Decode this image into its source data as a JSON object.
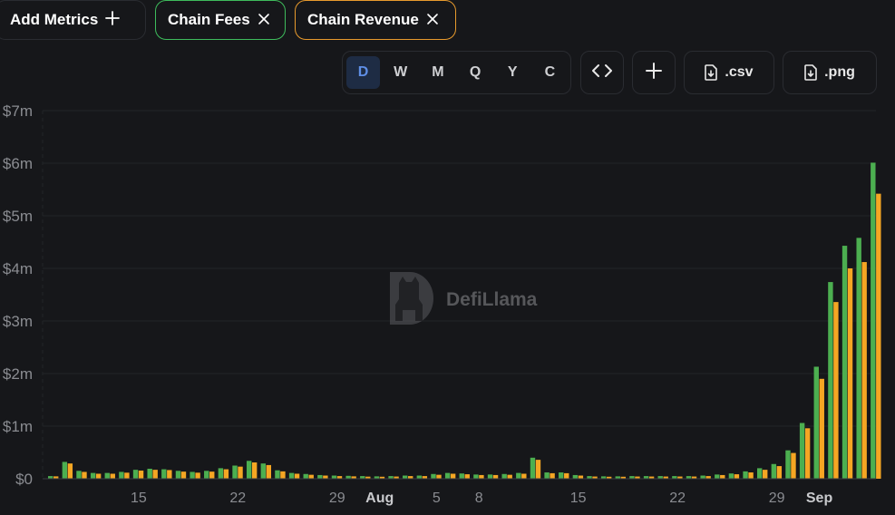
{
  "chips": {
    "add_metrics": "Add Metrics",
    "fees": "Chain Fees",
    "revenue": "Chain Revenue"
  },
  "toolbar": {
    "periods": [
      "D",
      "W",
      "M",
      "Q",
      "Y",
      "C"
    ],
    "active_period": "D",
    "csv_label": ".csv",
    "png_label": ".png"
  },
  "icons": {
    "add": "plus-icon",
    "remove": "close-icon",
    "embed": "code-brackets-icon",
    "download": "file-download-icon"
  },
  "watermark": "DefiLlama",
  "chart_data": {
    "type": "bar",
    "title": "",
    "xlabel": "",
    "ylabel": "",
    "ylim": [
      0,
      7000000
    ],
    "yticks": [
      "$0",
      "$1m",
      "$2m",
      "$3m",
      "$4m",
      "$5m",
      "$6m",
      "$7m"
    ],
    "ytick_values": [
      0,
      1000000,
      2000000,
      3000000,
      4000000,
      5000000,
      6000000,
      7000000
    ],
    "xticks": [
      {
        "label": "15",
        "index": 6,
        "major": false
      },
      {
        "label": "22",
        "index": 13,
        "major": false
      },
      {
        "label": "29",
        "index": 20,
        "major": false
      },
      {
        "label": "Aug",
        "index": 23,
        "major": true
      },
      {
        "label": "5",
        "index": 27,
        "major": false
      },
      {
        "label": "8",
        "index": 30,
        "major": false
      },
      {
        "label": "15",
        "index": 37,
        "major": false
      },
      {
        "label": "22",
        "index": 44,
        "major": false
      },
      {
        "label": "29",
        "index": 51,
        "major": false
      },
      {
        "label": "Sep",
        "index": 54,
        "major": true
      }
    ],
    "series": [
      {
        "name": "Chain Fees",
        "color": "#4caf50",
        "values": [
          50000,
          320000,
          150000,
          110000,
          110000,
          130000,
          170000,
          190000,
          180000,
          150000,
          130000,
          150000,
          200000,
          250000,
          340000,
          290000,
          160000,
          110000,
          90000,
          70000,
          60000,
          55000,
          50000,
          45000,
          50000,
          60000,
          60000,
          90000,
          110000,
          100000,
          80000,
          80000,
          90000,
          110000,
          400000,
          120000,
          120000,
          70000,
          50000,
          45000,
          45000,
          50000,
          50000,
          50000,
          50000,
          50000,
          60000,
          80000,
          100000,
          140000,
          200000,
          280000,
          540000,
          1060000,
          2130000,
          3740000,
          4430000,
          4580000,
          6010000
        ]
      },
      {
        "name": "Chain Revenue",
        "color": "#f5a623",
        "values": [
          45000,
          290000,
          130000,
          95000,
          95000,
          115000,
          155000,
          170000,
          165000,
          135000,
          115000,
          135000,
          180000,
          230000,
          310000,
          260000,
          140000,
          95000,
          75000,
          60000,
          50000,
          45000,
          40000,
          38000,
          42000,
          50000,
          50000,
          75000,
          95000,
          85000,
          70000,
          70000,
          75000,
          95000,
          360000,
          105000,
          105000,
          60000,
          42000,
          38000,
          38000,
          42000,
          42000,
          42000,
          42000,
          42000,
          50000,
          70000,
          85000,
          120000,
          170000,
          240000,
          490000,
          960000,
          1900000,
          3360000,
          4000000,
          4120000,
          5420000
        ]
      }
    ],
    "grid": true,
    "legend": "none"
  }
}
